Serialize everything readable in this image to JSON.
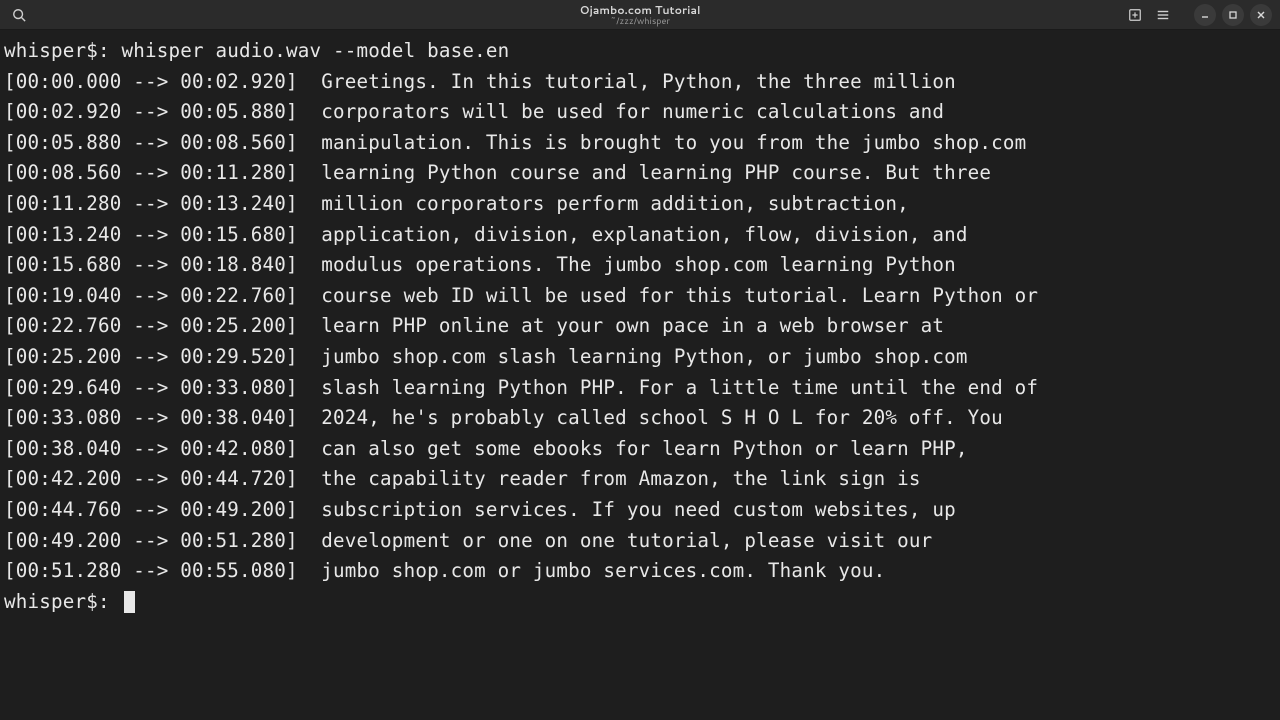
{
  "window": {
    "title": "Ojambo.com Tutorial",
    "subtitle": "~/zzz/whisper"
  },
  "terminal": {
    "prompt": "whisper$:",
    "command": "whisper audio.wav --model base.en",
    "segments": [
      {
        "start": "00:00.000",
        "end": "00:02.920",
        "text": "Greetings. In this tutorial, Python, the three million"
      },
      {
        "start": "00:02.920",
        "end": "00:05.880",
        "text": "corporators will be used for numeric calculations and"
      },
      {
        "start": "00:05.880",
        "end": "00:08.560",
        "text": "manipulation. This is brought to you from the jumbo shop.com"
      },
      {
        "start": "00:08.560",
        "end": "00:11.280",
        "text": "learning Python course and learning PHP course. But three"
      },
      {
        "start": "00:11.280",
        "end": "00:13.240",
        "text": "million corporators perform addition, subtraction,"
      },
      {
        "start": "00:13.240",
        "end": "00:15.680",
        "text": "application, division, explanation, flow, division, and"
      },
      {
        "start": "00:15.680",
        "end": "00:18.840",
        "text": "modulus operations. The jumbo shop.com learning Python"
      },
      {
        "start": "00:19.040",
        "end": "00:22.760",
        "text": "course web ID will be used for this tutorial. Learn Python or"
      },
      {
        "start": "00:22.760",
        "end": "00:25.200",
        "text": "learn PHP online at your own pace in a web browser at"
      },
      {
        "start": "00:25.200",
        "end": "00:29.520",
        "text": "jumbo shop.com slash learning Python, or jumbo shop.com"
      },
      {
        "start": "00:29.640",
        "end": "00:33.080",
        "text": "slash learning Python PHP. For a little time until the end of"
      },
      {
        "start": "00:33.080",
        "end": "00:38.040",
        "text": "2024, he's probably called school S H O L for 20% off. You"
      },
      {
        "start": "00:38.040",
        "end": "00:42.080",
        "text": "can also get some ebooks for learn Python or learn PHP,"
      },
      {
        "start": "00:42.200",
        "end": "00:44.720",
        "text": "the capability reader from Amazon, the link sign is"
      },
      {
        "start": "00:44.760",
        "end": "00:49.200",
        "text": "subscription services. If you need custom websites, up"
      },
      {
        "start": "00:49.200",
        "end": "00:51.280",
        "text": "development or one on one tutorial, please visit our"
      },
      {
        "start": "00:51.280",
        "end": "00:55.080",
        "text": "jumbo shop.com or jumbo services.com. Thank you."
      }
    ],
    "final_prompt": "whisper$:"
  }
}
